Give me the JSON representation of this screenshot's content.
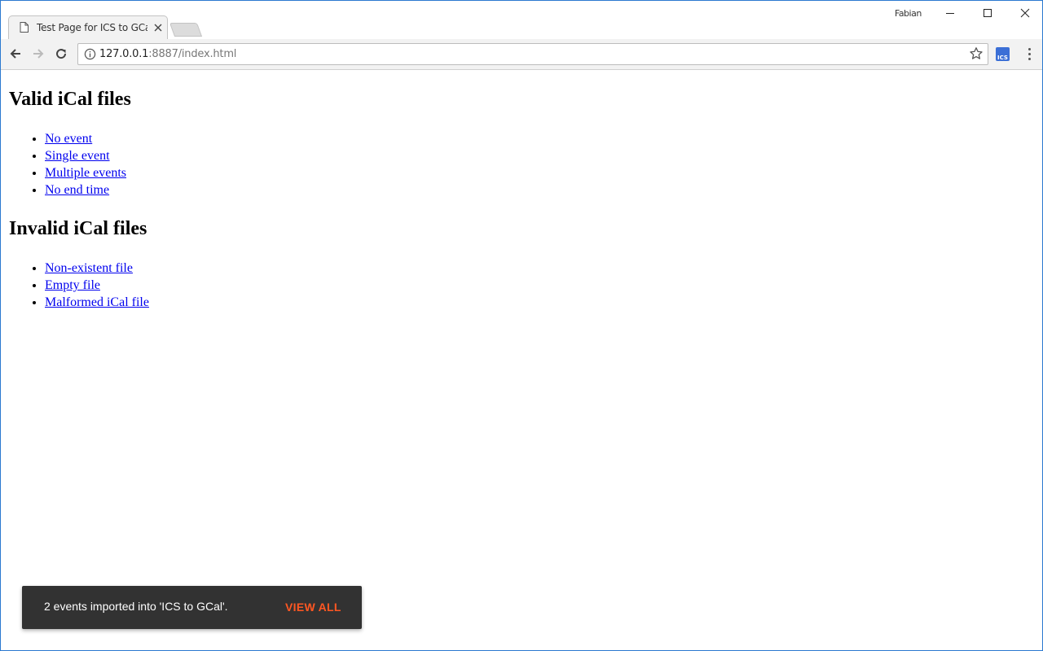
{
  "browser": {
    "tab_title": "Test Page for ICS to GCal",
    "profile_name": "Fabian",
    "url_host": "127.0.0.1",
    "url_rest": ":8887/index.html",
    "extension_label": "ICS"
  },
  "page": {
    "valid_heading": "Valid iCal files",
    "valid_links": [
      "No event",
      "Single event",
      "Multiple events",
      "No end time"
    ],
    "invalid_heading": "Invalid iCal files",
    "invalid_links": [
      "Non-existent file",
      "Empty file",
      "Malformed iCal file"
    ]
  },
  "snackbar": {
    "message": "2 events imported into 'ICS to GCal'.",
    "action": "VIEW ALL",
    "action_color": "#ff5722"
  }
}
